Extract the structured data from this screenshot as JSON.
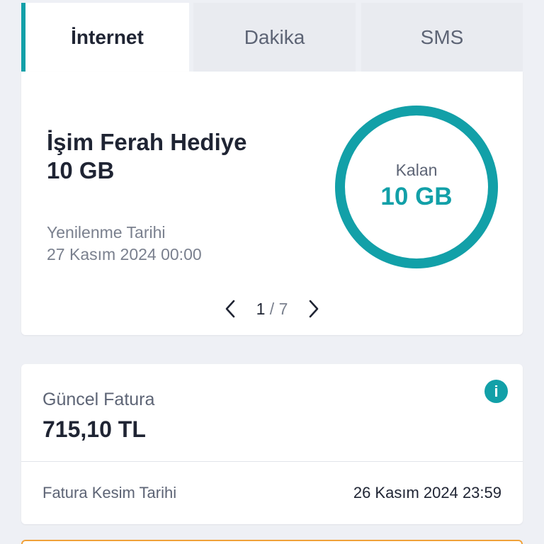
{
  "tabs": [
    {
      "label": "İnternet",
      "active": true
    },
    {
      "label": "Dakika",
      "active": false
    },
    {
      "label": "SMS",
      "active": false
    }
  ],
  "package": {
    "title_line1": "İşim Ferah Hediye",
    "title_line2": "10 GB",
    "renewal_label": "Yenilenme Tarihi",
    "renewal_date": "27 Kasım 2024 00:00",
    "remaining_label": "Kalan",
    "remaining_value": "10 GB",
    "remaining_fraction": 1.0,
    "pager": {
      "current": "1",
      "separator": "/",
      "total": "7"
    }
  },
  "bill": {
    "label": "Güncel Fatura",
    "amount": "715,10 TL",
    "cut_label": "Fatura Kesim Tarihi",
    "cut_date": "26 Kasım 2024 23:59"
  },
  "colors": {
    "accent": "#12a0a8",
    "warning_border": "#f0a23a",
    "background": "#eef0f5"
  },
  "icons": {
    "prev": "chevron-left-icon",
    "next": "chevron-right-icon",
    "info": "info-icon"
  }
}
